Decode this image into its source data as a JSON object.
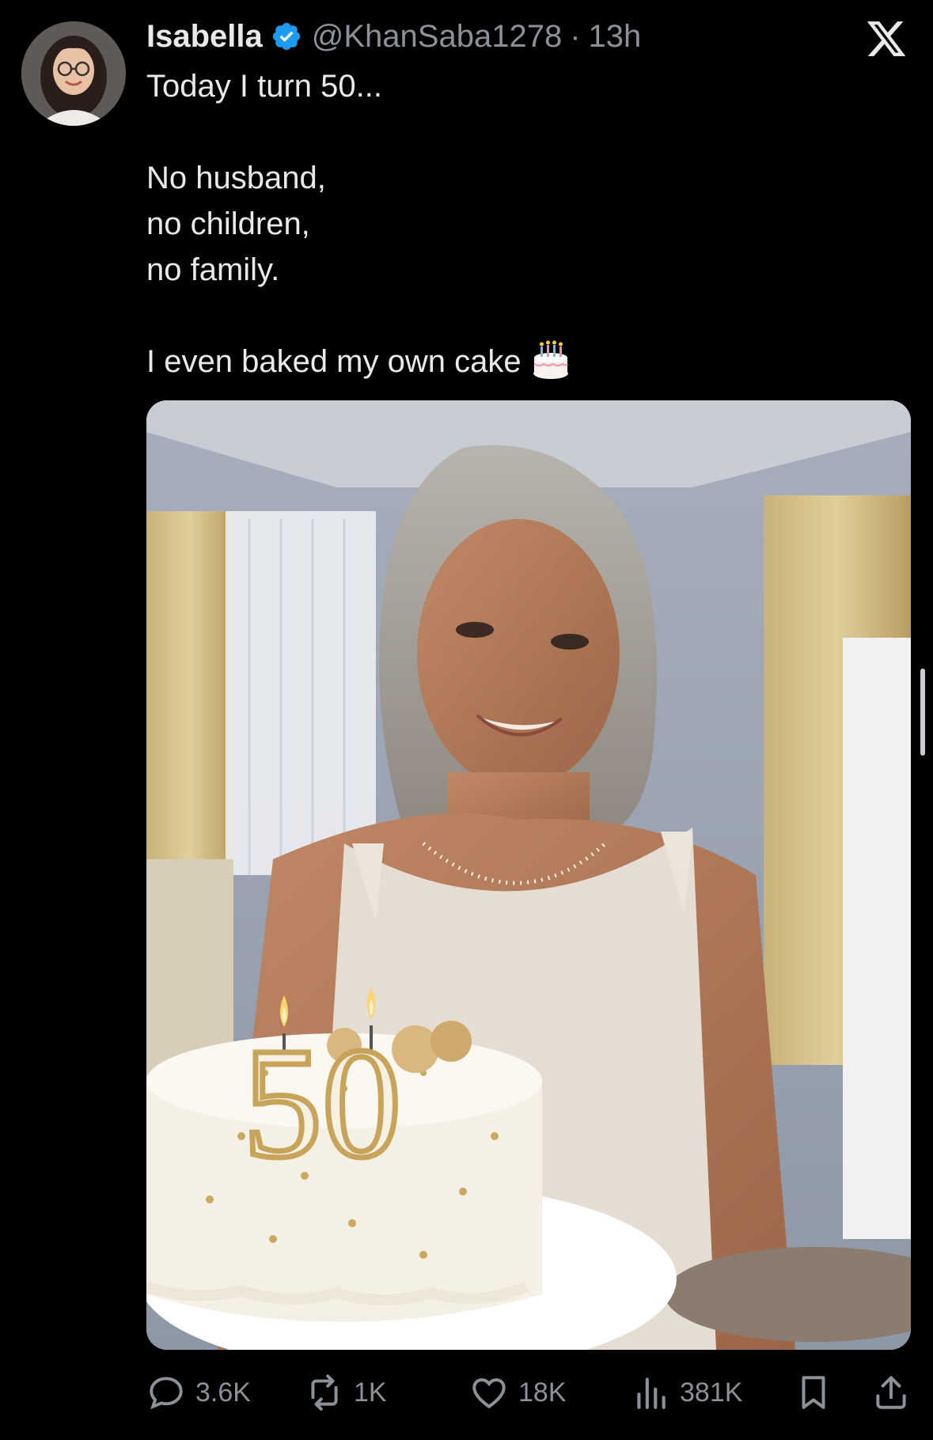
{
  "tweet": {
    "author_name": "Isabella",
    "handle": "@KhanSaba1278",
    "separator": "·",
    "time": "13h",
    "text": "Today I turn 50...\n\nNo husband,\nno children,\nno family.\n\nI even baked my own cake"
  },
  "media": {
    "candle_number": "50"
  },
  "actions": {
    "replies": "3.6K",
    "reposts": "1K",
    "likes": "18K",
    "views": "381K"
  },
  "colors": {
    "background": "#000000",
    "text": "#e7e9ea",
    "secondary": "#8b9196",
    "verified": "#1d9bf0"
  }
}
